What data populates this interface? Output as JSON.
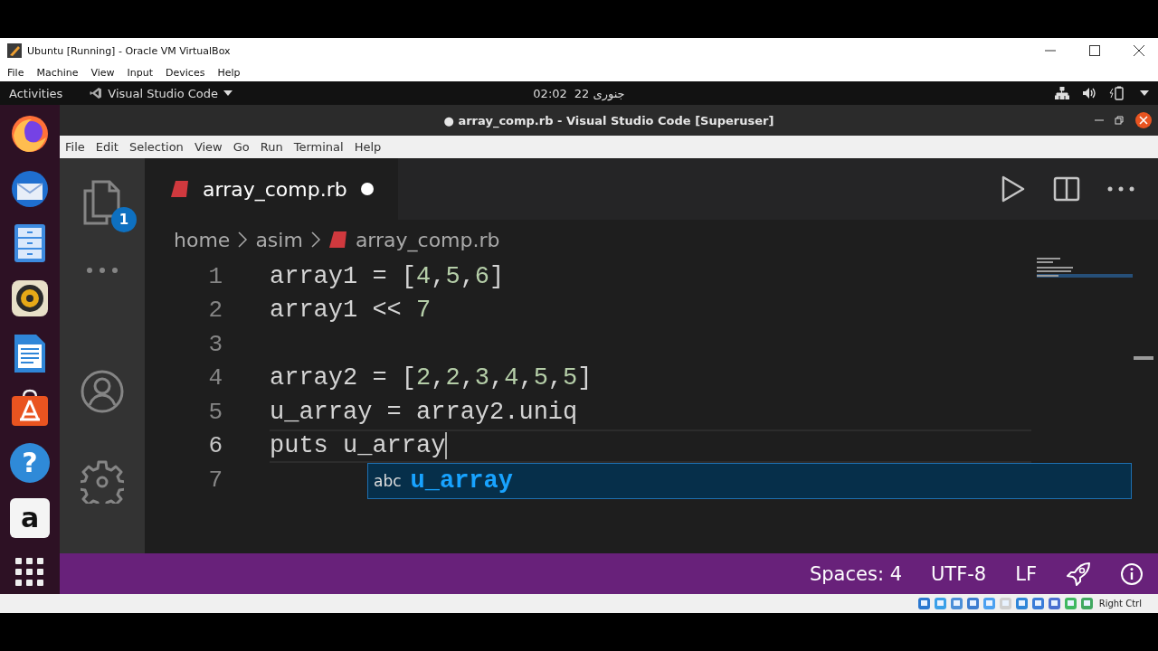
{
  "vbox": {
    "title": "Ubuntu [Running] - Oracle VM VirtualBox",
    "menu": [
      "File",
      "Machine",
      "View",
      "Input",
      "Devices",
      "Help"
    ],
    "status_label": "Right Ctrl"
  },
  "topbar": {
    "activities": "Activities",
    "app": "Visual Studio Code",
    "clock_time": "02:02",
    "clock_date": "22 جنوری"
  },
  "dock": {
    "help_glyph": "?",
    "store_glyph": "a"
  },
  "vscode": {
    "title_dot": "●",
    "title": "array_comp.rb - Visual Studio Code [Superuser]",
    "menu": [
      "File",
      "Edit",
      "Selection",
      "View",
      "Go",
      "Run",
      "Terminal",
      "Help"
    ],
    "explorer_badge": "1",
    "tab": {
      "label": "array_comp.rb",
      "modified": true
    },
    "breadcrumb": [
      "home",
      "asim",
      "array_comp.rb"
    ],
    "lines": [
      {
        "number": "1",
        "current": false,
        "cursor": false,
        "tokens": [
          {
            "text": "array1 = [",
            "kind": "plain"
          },
          {
            "text": "4",
            "kind": "number"
          },
          {
            "text": ",",
            "kind": "plain"
          },
          {
            "text": "5",
            "kind": "number"
          },
          {
            "text": ",",
            "kind": "plain"
          },
          {
            "text": "6",
            "kind": "number"
          },
          {
            "text": "]",
            "kind": "plain"
          }
        ]
      },
      {
        "number": "2",
        "current": false,
        "cursor": false,
        "tokens": [
          {
            "text": "array1 << ",
            "kind": "plain"
          },
          {
            "text": "7",
            "kind": "number"
          }
        ]
      },
      {
        "number": "3",
        "current": false,
        "cursor": false
      },
      {
        "number": "4",
        "current": false,
        "cursor": false,
        "tokens": [
          {
            "text": "array2 = [",
            "kind": "plain"
          },
          {
            "text": "2",
            "kind": "number"
          },
          {
            "text": ",",
            "kind": "plain"
          },
          {
            "text": "2",
            "kind": "number"
          },
          {
            "text": ",",
            "kind": "plain"
          },
          {
            "text": "3",
            "kind": "number"
          },
          {
            "text": ",",
            "kind": "plain"
          },
          {
            "text": "4",
            "kind": "number"
          },
          {
            "text": ",",
            "kind": "plain"
          },
          {
            "text": "5",
            "kind": "number"
          },
          {
            "text": ",",
            "kind": "plain"
          },
          {
            "text": "5",
            "kind": "number"
          },
          {
            "text": "]",
            "kind": "plain"
          }
        ]
      },
      {
        "number": "5",
        "current": false,
        "cursor": false,
        "tokens": [
          {
            "text": "u_array = array2.uniq",
            "kind": "plain"
          }
        ]
      },
      {
        "number": "6",
        "current": true,
        "cursor": true,
        "tokens": [
          {
            "text": "puts u_array",
            "kind": "plain"
          }
        ]
      },
      {
        "number": "7",
        "current": false,
        "cursor": false
      }
    ],
    "suggestion": {
      "kind_label": "abc",
      "text": "u_array"
    },
    "status": [
      "Spaces: 4",
      "UTF-8",
      "LF"
    ]
  }
}
